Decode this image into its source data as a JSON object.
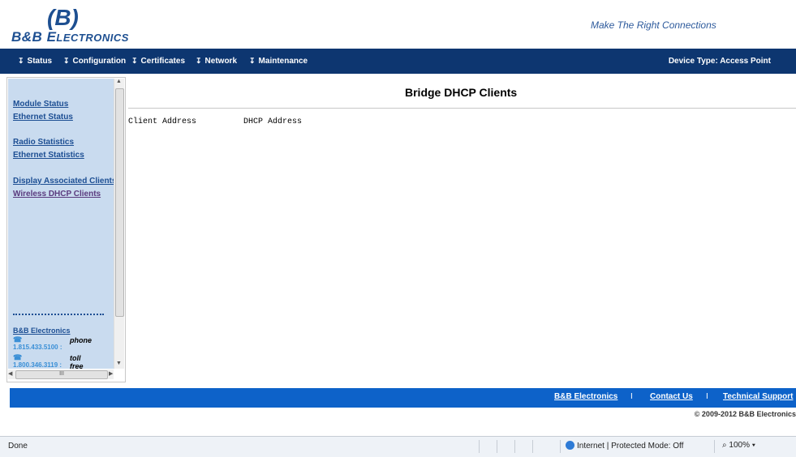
{
  "header": {
    "logo_mark": "(B)",
    "logo_name_first": "B&B",
    "logo_name_e": "E",
    "logo_name_rest": "LECTRONICS",
    "tagline": "Make The Right Connections"
  },
  "nav": {
    "items": [
      {
        "label": "Status"
      },
      {
        "label": "Configuration"
      },
      {
        "label": "Certificates"
      },
      {
        "label": "Network"
      },
      {
        "label": "Maintenance"
      }
    ],
    "device_type": "Device Type: Access Point"
  },
  "sidebar": {
    "links": [
      {
        "label": "Module Status"
      },
      {
        "label": "Ethernet Status"
      },
      {
        "label": "Radio Statistics"
      },
      {
        "label": "Ethernet Statistics"
      },
      {
        "label": "Display Associated Clients"
      },
      {
        "label": "Wireless DHCP Clients"
      }
    ],
    "company": "B&B Electronics",
    "phones": [
      {
        "number": "1.815.433.5100",
        "sep": ":",
        "label": "phone"
      },
      {
        "number": "1.800.346.3119",
        "sep": ":",
        "label": "toll free"
      }
    ],
    "hscroll_grip": "III"
  },
  "main": {
    "title": "Bridge DHCP Clients",
    "columns": [
      "Client Address",
      "DHCP Address"
    ]
  },
  "footer": {
    "links": [
      "B&B Electronics",
      "Contact Us",
      "Technical Support"
    ],
    "separator": "I",
    "copyright": "© 2009-2012 B&B Electronics"
  },
  "statusbar": {
    "text": "Done",
    "zone": "Internet | Protected Mode: Off",
    "zoom": "100%"
  },
  "colors": {
    "nav_bg": "#0d3670",
    "footer_bg": "#0d62c9",
    "sidebar_bg": "#c9dbef",
    "link": "#1c4e93"
  }
}
